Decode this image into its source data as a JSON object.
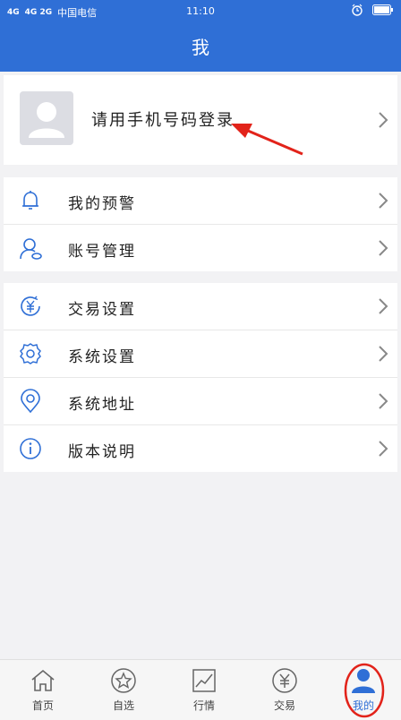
{
  "status": {
    "signal1": "4G",
    "signal2": "4G 2G",
    "carrier": "中国电信",
    "time": "11:10"
  },
  "header": {
    "title": "我"
  },
  "profile": {
    "login_prompt": "请用手机号码登录"
  },
  "groups": [
    {
      "items": [
        {
          "label": "我的预警",
          "icon": "bell-icon"
        },
        {
          "label": "账号管理",
          "icon": "account-icon"
        }
      ]
    },
    {
      "items": [
        {
          "label": "交易设置",
          "icon": "yen-icon"
        },
        {
          "label": "系统设置",
          "icon": "gear-icon"
        },
        {
          "label": "系统地址",
          "icon": "location-icon"
        },
        {
          "label": "版本说明",
          "icon": "info-icon"
        }
      ]
    }
  ],
  "tabbar": {
    "items": [
      {
        "label": "首页",
        "icon": "home-icon"
      },
      {
        "label": "自选",
        "icon": "star-icon"
      },
      {
        "label": "行情",
        "icon": "chart-icon"
      },
      {
        "label": "交易",
        "icon": "yen-icon"
      },
      {
        "label": "我的",
        "icon": "user-icon",
        "active": true
      }
    ]
  },
  "colors": {
    "primary": "#2f6fd6",
    "highlight": "#e2231a"
  }
}
